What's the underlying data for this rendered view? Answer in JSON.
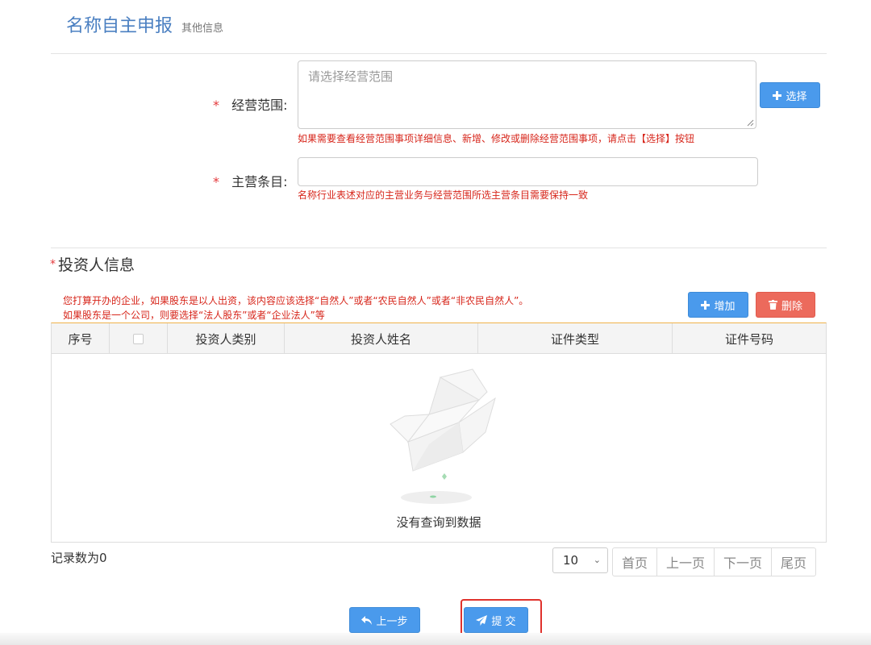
{
  "header": {
    "title": "名称自主申报",
    "subtitle": "其他信息"
  },
  "form": {
    "required_mark": "*",
    "scope": {
      "label": "经营范围:",
      "placeholder": "请选择经营范围",
      "value": "",
      "select_button": "选择",
      "hint": "如果需要查看经营范围事项详细信息、新增、修改或删除经营范围事项，请点击【选择】按钮"
    },
    "main_item": {
      "label": "主营条目:",
      "value": "",
      "hint": "名称行业表述对应的主营业务与经营范围所选主营条目需要保持一致"
    }
  },
  "investors": {
    "required_mark": "*",
    "title": "投资人信息",
    "notice_line1": "您打算开办的企业，如果股东是以人出资，该内容应该选择“自然人”或者“农民自然人”或者“非农民自然人”。",
    "notice_line2": "如果股东是一个公司，则要选择“法人股东”或者“企业法人”等",
    "add_button": "增加",
    "delete_button": "删除",
    "columns": [
      "序号",
      "",
      "投资人类别",
      "投资人姓名",
      "证件类型",
      "证件号码"
    ],
    "rows": [],
    "empty_text": "没有查询到数据"
  },
  "pagination": {
    "records_text": "记录数为0",
    "page_size": "10",
    "first": "首页",
    "prev": "上一页",
    "next": "下一页",
    "last": "尾页"
  },
  "footer": {
    "prev_step": "上一步",
    "submit": "提 交"
  },
  "colors": {
    "primary": "#4a9aec",
    "danger": "#ec6a5c",
    "hint_red": "#d7261b",
    "title_blue": "#4a7fc1"
  }
}
